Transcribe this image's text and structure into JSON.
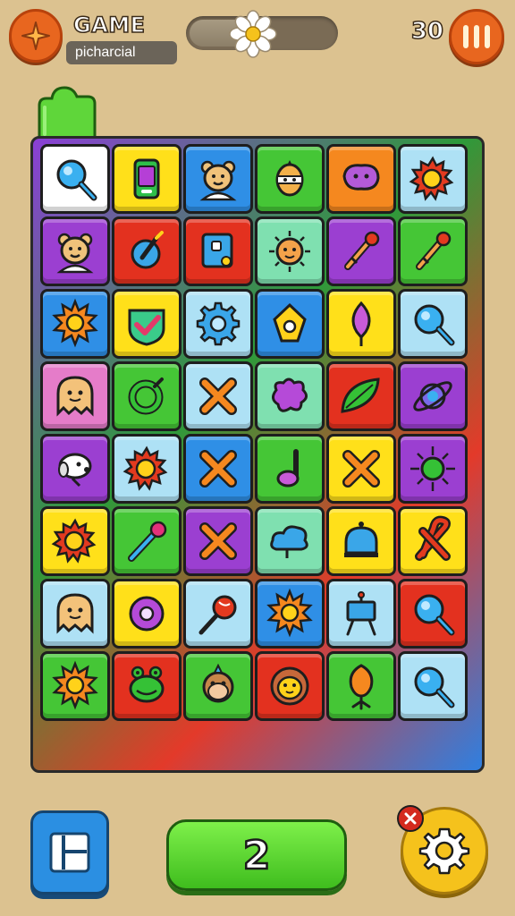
{
  "header": {
    "title": "GAME",
    "subtitle": "picharcial",
    "score": "30"
  },
  "colors": {
    "yellow": "#ffe01a",
    "green": "#45c636",
    "blue": "#2f8fe6",
    "lightblue": "#aee1f5",
    "orange": "#f5881f",
    "purple": "#9b3fd1",
    "red": "#e3311f",
    "mint": "#7fe0b0",
    "pink": "#e57cc9",
    "white": "#ffffff"
  },
  "board": {
    "rows": 8,
    "cols": 6,
    "tiles": [
      [
        "white:magnifier-icon",
        "yellow:phone-icon",
        "blue:bear-icon",
        "green:ninja-icon",
        "orange:blob-face-icon",
        "lightblue:sun-gear-icon"
      ],
      [
        "purple:bear-icon",
        "red:bomb-icon",
        "red:mirror-icon",
        "mint:sun-face-icon",
        "purple:key-icon",
        "green:key-icon"
      ],
      [
        "blue:sun-icon",
        "yellow:check-icon",
        "lightblue:gear-icon",
        "blue:tag-icon",
        "yellow:feather-icon",
        "lightblue:magnifier-icon"
      ],
      [
        "pink:ghost-icon",
        "green:ring-icon",
        "lightblue:x-icon",
        "mint:splat-icon",
        "red:leaf-icon",
        "purple:planet-icon"
      ],
      [
        "purple:dog-icon",
        "lightblue:sun-gear-icon",
        "blue:x-icon",
        "green:note-icon",
        "yellow:x-icon",
        "purple:star-icon"
      ],
      [
        "yellow:sun-gear-icon",
        "green:pin-icon",
        "purple:x-icon",
        "mint:cloud-icon",
        "yellow:bell-icon",
        "yellow:pretzel-icon"
      ],
      [
        "lightblue:ghost-icon",
        "yellow:donut-icon",
        "lightblue:lollipop-icon",
        "blue:sun-icon",
        "lightblue:easel-icon",
        "red:magnifier-icon"
      ],
      [
        "green:sun-icon",
        "red:frog-icon",
        "green:monkey-icon",
        "red:lion-icon",
        "green:flower-icon",
        "lightblue:magnifier-icon"
      ]
    ]
  },
  "footer": {
    "level": "2"
  },
  "icons": {
    "logo": "star-icon",
    "pause": "pause-icon",
    "progress_marker": "daisy-icon",
    "menu": "panel-menu-icon",
    "settings": "gear-icon",
    "close": "close-icon",
    "top_left_tab": "green-tab-icon"
  },
  "progress": {
    "fill_percent": 0.45
  }
}
